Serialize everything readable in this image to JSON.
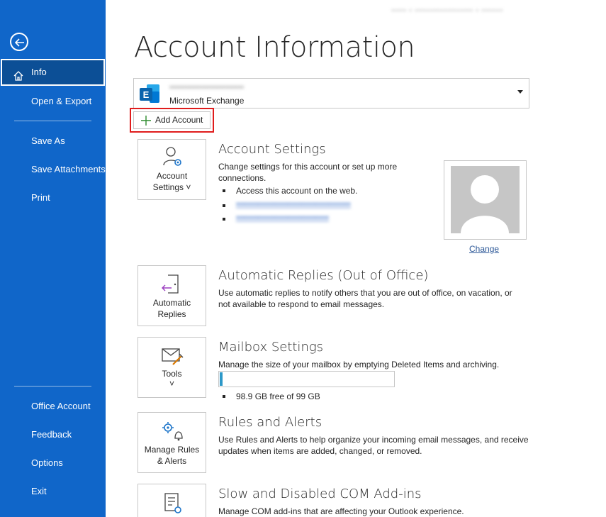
{
  "top_account_email": "••••• • ••••••••••••••••••• • •••••••",
  "sidebar": {
    "items": [
      {
        "label": "Info"
      },
      {
        "label": "Open & Export"
      },
      {
        "label": "Save As"
      },
      {
        "label": "Save Attachments"
      },
      {
        "label": "Print"
      },
      {
        "label": "Office Account"
      },
      {
        "label": "Feedback"
      },
      {
        "label": "Options"
      },
      {
        "label": "Exit"
      }
    ]
  },
  "page_title": "Account Information",
  "account": {
    "email": "•••••••••••••••••••••••••",
    "type": "Microsoft Exchange",
    "add_account_label": "Add Account"
  },
  "account_settings": {
    "tile_label_1": "Account",
    "tile_label_2": "Settings ˅",
    "title": "Account Settings",
    "desc": "Change settings for this account or set up more connections.",
    "bullet_1": "Access this account on the web.",
    "link_1": "••••••••••••••••••••••••••••••••••••••••••",
    "link_2": "••••••••••••••••••••••••••••••••••",
    "change_label": "Change"
  },
  "auto_replies": {
    "tile_label_1": "Automatic",
    "tile_label_2": "Replies",
    "title": "Automatic Replies (Out of Office)",
    "desc_1": "Use automatic replies to notify others that you are out of office, on vacation, or",
    "desc_2": "not available to respond to email messages."
  },
  "mailbox": {
    "tile_label_1": "Tools",
    "tile_label_2": "˅",
    "title": "Mailbox Settings",
    "desc": "Manage the size of your mailbox by emptying Deleted Items and archiving.",
    "free_text": "98.9 GB free of 99 GB",
    "used_fraction": 0.011,
    "bar_color": "#2d98c8"
  },
  "rules": {
    "tile_label_1": "Manage Rules",
    "tile_label_2": "& Alerts",
    "title": "Rules and Alerts",
    "desc_1": "Use Rules and Alerts to help organize your incoming email messages, and receive",
    "desc_2": "updates when items are added, changed, or removed."
  },
  "com_addins": {
    "title": "Slow and Disabled COM Add-ins",
    "desc": "Manage COM add-ins that are affecting your Outlook experience."
  },
  "colors": {
    "sidebar_bg": "#1066c9",
    "sidebar_active": "#0c4f96",
    "highlight_red": "#e01c1c",
    "link": "#2b5797"
  },
  "icons": [
    "back-arrow-icon",
    "home-icon",
    "exchange-logo-icon",
    "plus-icon",
    "account-settings-icon",
    "door-arrow-icon",
    "mailbox-tools-icon",
    "rules-alerts-icon",
    "addins-icon",
    "person-silhouette-icon"
  ]
}
